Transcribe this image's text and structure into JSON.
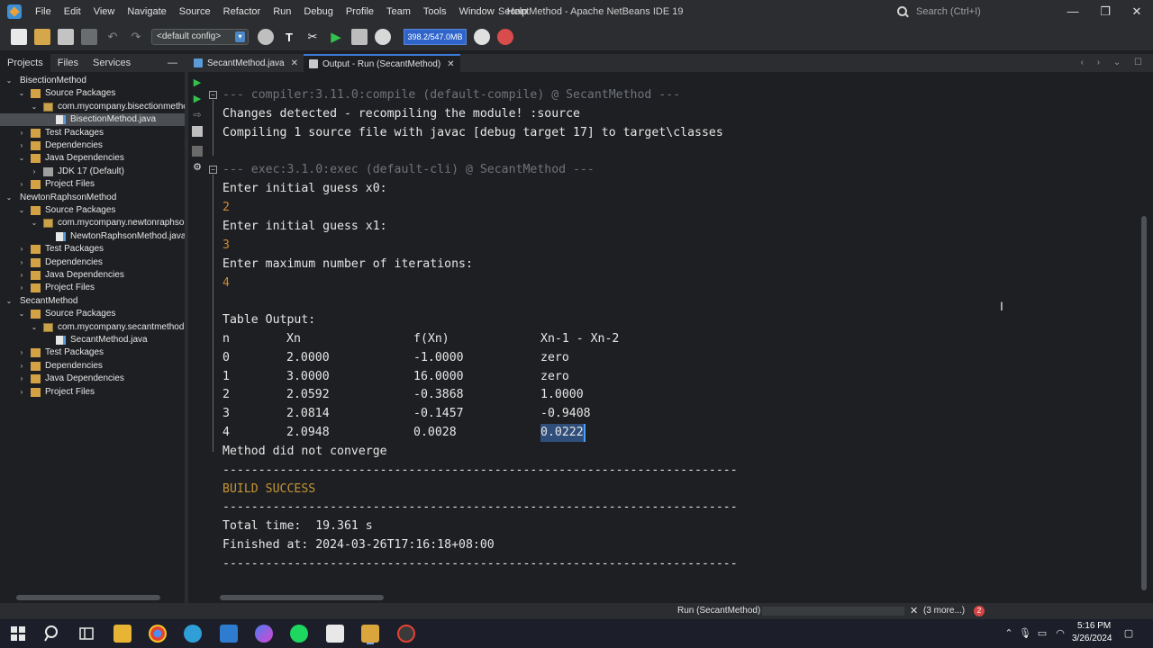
{
  "menubar": {
    "items": [
      "File",
      "Edit",
      "View",
      "Navigate",
      "Source",
      "Refactor",
      "Run",
      "Debug",
      "Profile",
      "Team",
      "Tools",
      "Window",
      "Help"
    ],
    "title": "SecantMethod - Apache NetBeans IDE 19",
    "search_placeholder": "Search (Ctrl+I)",
    "minimize": "—",
    "maximize": "❐",
    "close": "✕"
  },
  "toolbar": {
    "config": "<default config>",
    "memory": "398.2/547.0MB"
  },
  "left_panel": {
    "tabs": [
      "Projects",
      "Files",
      "Services"
    ],
    "minimize": "—",
    "tree": [
      {
        "label": "BisectionMethod",
        "depth": 0,
        "expanded": true,
        "icon": "project"
      },
      {
        "label": "Source Packages",
        "depth": 1,
        "expanded": true,
        "icon": "folder"
      },
      {
        "label": "com.mycompany.bisectionmethod",
        "depth": 2,
        "expanded": true,
        "icon": "package"
      },
      {
        "label": "BisectionMethod.java",
        "depth": 3,
        "expanded": null,
        "icon": "file",
        "selected": true
      },
      {
        "label": "Test Packages",
        "depth": 1,
        "expanded": false,
        "icon": "folder"
      },
      {
        "label": "Dependencies",
        "depth": 1,
        "expanded": false,
        "icon": "folder"
      },
      {
        "label": "Java Dependencies",
        "depth": 1,
        "expanded": true,
        "icon": "folder"
      },
      {
        "label": "JDK 17 (Default)",
        "depth": 2,
        "expanded": false,
        "icon": "jdk"
      },
      {
        "label": "Project Files",
        "depth": 1,
        "expanded": false,
        "icon": "folder"
      },
      {
        "label": "NewtonRaphsonMethod",
        "depth": 0,
        "expanded": true,
        "icon": "project"
      },
      {
        "label": "Source Packages",
        "depth": 1,
        "expanded": true,
        "icon": "folder"
      },
      {
        "label": "com.mycompany.newtonraphsonm",
        "depth": 2,
        "expanded": true,
        "icon": "package"
      },
      {
        "label": "NewtonRaphsonMethod.java",
        "depth": 3,
        "expanded": null,
        "icon": "file"
      },
      {
        "label": "Test Packages",
        "depth": 1,
        "expanded": false,
        "icon": "folder"
      },
      {
        "label": "Dependencies",
        "depth": 1,
        "expanded": false,
        "icon": "folder"
      },
      {
        "label": "Java Dependencies",
        "depth": 1,
        "expanded": false,
        "icon": "folder"
      },
      {
        "label": "Project Files",
        "depth": 1,
        "expanded": false,
        "icon": "folder"
      },
      {
        "label": "SecantMethod",
        "depth": 0,
        "expanded": true,
        "icon": "project"
      },
      {
        "label": "Source Packages",
        "depth": 1,
        "expanded": true,
        "icon": "folder"
      },
      {
        "label": "com.mycompany.secantmethod",
        "depth": 2,
        "expanded": true,
        "icon": "package"
      },
      {
        "label": "SecantMethod.java",
        "depth": 3,
        "expanded": null,
        "icon": "file"
      },
      {
        "label": "Test Packages",
        "depth": 1,
        "expanded": false,
        "icon": "folder"
      },
      {
        "label": "Dependencies",
        "depth": 1,
        "expanded": false,
        "icon": "folder"
      },
      {
        "label": "Java Dependencies",
        "depth": 1,
        "expanded": false,
        "icon": "folder"
      },
      {
        "label": "Project Files",
        "depth": 1,
        "expanded": false,
        "icon": "folder"
      }
    ]
  },
  "editor_tabs": [
    {
      "label": "SecantMethod.java",
      "active": false
    },
    {
      "label": "Output - Run (SecantMethod)",
      "active": true
    }
  ],
  "output": {
    "compile_header": "--- compiler:3.11.0:compile (default-compile) @ SecantMethod ---",
    "changes": "Changes detected - recompiling the module! :source",
    "compiling": "Compiling 1 source file with javac [debug target 17] to target\\classes",
    "exec_header": "--- exec:3.1.0:exec (default-cli) @ SecantMethod ---",
    "prompt_x0": "Enter initial guess x0:",
    "input_x0": "2",
    "prompt_x1": "Enter initial guess x1:",
    "input_x1": "3",
    "prompt_iter": "Enter maximum number of iterations:",
    "input_iter": "4",
    "table_title": "Table Output:",
    "table_headers": [
      "n",
      "Xn",
      "f(Xn)",
      "Xn-1 - Xn-2"
    ],
    "table_rows": [
      [
        "0",
        "2.0000",
        "-1.0000",
        "zero"
      ],
      [
        "1",
        "3.0000",
        "16.0000",
        "zero"
      ],
      [
        "2",
        "2.0592",
        "-0.3868",
        "1.0000"
      ],
      [
        "3",
        "2.0814",
        "-0.1457",
        "-0.9408"
      ],
      [
        "4",
        "2.0948",
        "0.0028",
        "0.0222"
      ]
    ],
    "not_converge": "Method did not converge",
    "separator": "------------------------------------------------------------------------",
    "build_success": "BUILD SUCCESS",
    "total_time": "Total time:  19.361 s",
    "finished_at": "Finished at: 2024-03-26T17:16:18+08:00"
  },
  "statusbar": {
    "run_label": "Run (SecantMethod)",
    "close": "✕",
    "more": "(3 more...)",
    "badge": "2"
  },
  "taskbar": {
    "time": "5:16 PM",
    "date": "3/26/2024"
  }
}
